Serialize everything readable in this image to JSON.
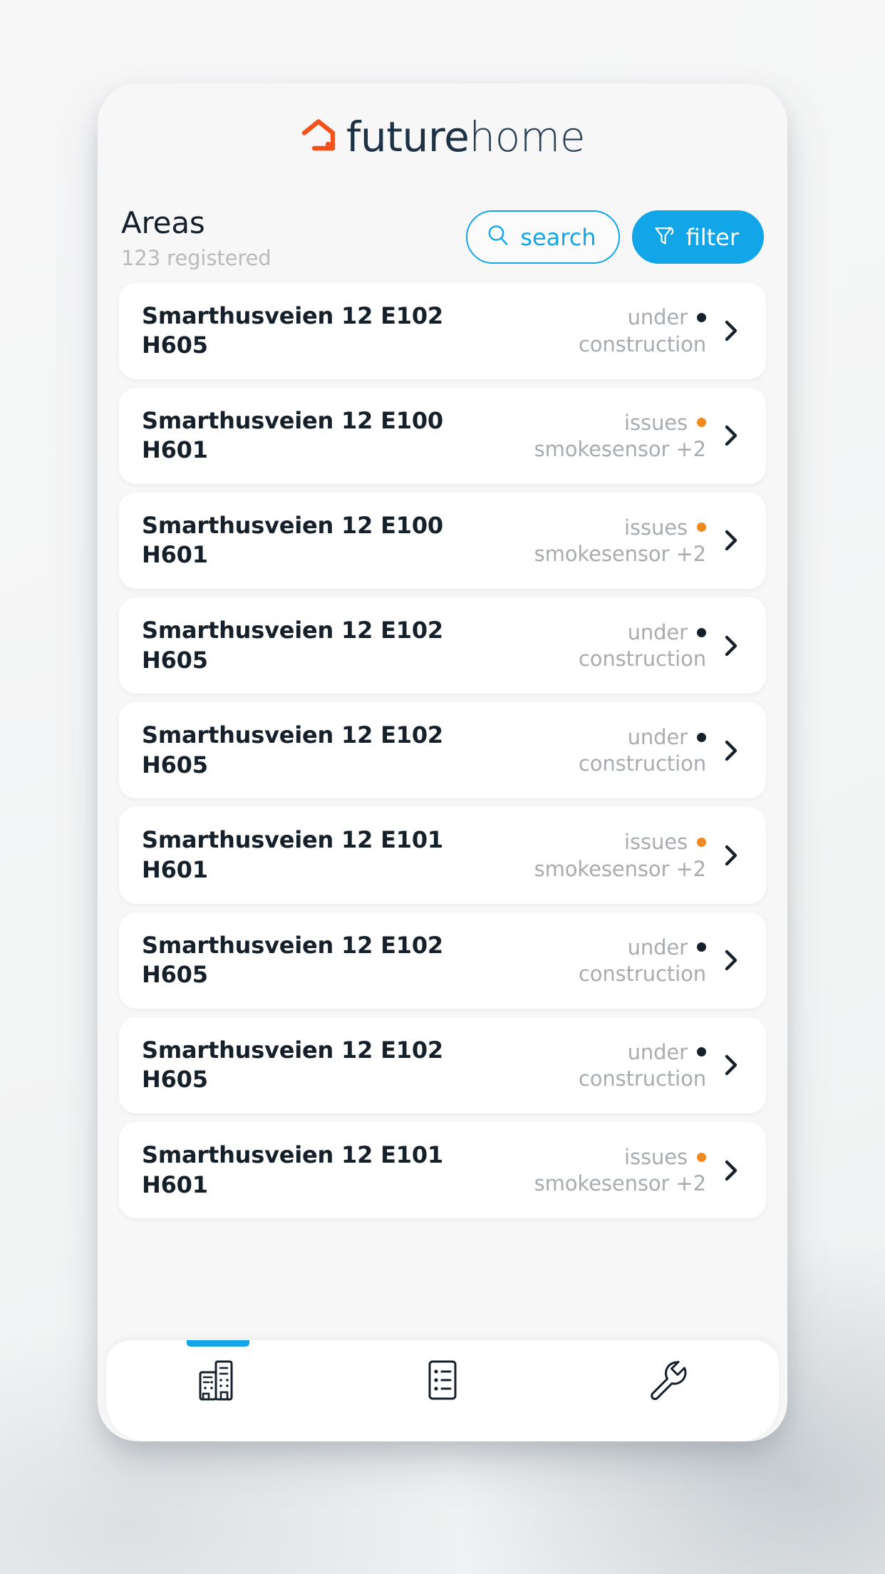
{
  "brand": {
    "name_bold": "future",
    "name_light": "home",
    "logo_icon": "house-outline-icon",
    "logo_color": "#f2511b",
    "wordmark_color": "#1d3244"
  },
  "header": {
    "title": "Areas",
    "subtitle": "123 registered",
    "search_label": "search",
    "search_icon": "magnifier-icon",
    "filter_label": "filter",
    "filter_icon": "funnel-icon",
    "accent_color": "#12a5e8"
  },
  "status_colors": {
    "under_construction": "#15202b",
    "issues": "#f08a1e"
  },
  "list": {
    "items": [
      {
        "title_line1": "Smarthusveien 12 E102",
        "title_line2": "H605",
        "status_line1": "under",
        "status_line2": "construction",
        "status_kind": "under_construction"
      },
      {
        "title_line1": "Smarthusveien 12 E100",
        "title_line2": "H601",
        "status_line1": "issues",
        "status_line2": "smokesensor +2",
        "status_kind": "issues"
      },
      {
        "title_line1": "Smarthusveien 12 E100",
        "title_line2": "H601",
        "status_line1": "issues",
        "status_line2": "smokesensor +2",
        "status_kind": "issues"
      },
      {
        "title_line1": "Smarthusveien 12 E102",
        "title_line2": "H605",
        "status_line1": "under",
        "status_line2": "construction",
        "status_kind": "under_construction"
      },
      {
        "title_line1": "Smarthusveien 12 E102",
        "title_line2": "H605",
        "status_line1": "under",
        "status_line2": "construction",
        "status_kind": "under_construction"
      },
      {
        "title_line1": "Smarthusveien 12 E101",
        "title_line2": "H601",
        "status_line1": "issues",
        "status_line2": "smokesensor +2",
        "status_kind": "issues"
      },
      {
        "title_line1": "Smarthusveien 12 E102",
        "title_line2": "H605",
        "status_line1": "under",
        "status_line2": "construction",
        "status_kind": "under_construction"
      },
      {
        "title_line1": "Smarthusveien 12 E102",
        "title_line2": "H605",
        "status_line1": "under",
        "status_line2": "construction",
        "status_kind": "under_construction"
      },
      {
        "title_line1": "Smarthusveien 12 E101",
        "title_line2": "H601",
        "status_line1": "issues",
        "status_line2": "smokesensor +2",
        "status_kind": "issues"
      }
    ],
    "chevron_icon": "chevron-right-icon"
  },
  "bottom_nav": {
    "active_index": 0,
    "indicator_color": "#12a5e8",
    "items": [
      {
        "icon": "buildings-icon",
        "name": "areas"
      },
      {
        "icon": "checklist-icon",
        "name": "tasks"
      },
      {
        "icon": "wrench-icon",
        "name": "tools"
      }
    ]
  }
}
